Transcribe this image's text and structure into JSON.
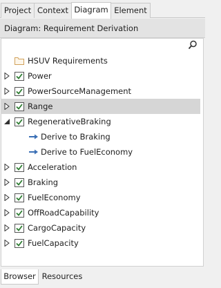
{
  "tabs": {
    "project": "Project",
    "context": "Context",
    "diagram": "Diagram",
    "element": "Element"
  },
  "diagram_bar": {
    "title": "Diagram: Requirement Derivation"
  },
  "search": {
    "icon": "search-icon"
  },
  "tree": {
    "package": "HSUV Requirements",
    "items": [
      {
        "label": "Power",
        "expander": "collapsed"
      },
      {
        "label": "PowerSourceManagement",
        "expander": "collapsed"
      },
      {
        "label": "Range",
        "expander": "collapsed",
        "selected": true
      },
      {
        "label": "RegenerativeBraking",
        "expander": "expanded"
      }
    ],
    "children": [
      {
        "label": "Derive to Braking"
      },
      {
        "label": "Derive to FuelEconomy"
      }
    ],
    "more": [
      {
        "label": "Acceleration"
      },
      {
        "label": "Braking"
      },
      {
        "label": "FuelEconomy"
      },
      {
        "label": "OffRoadCapability"
      },
      {
        "label": "CargoCapacity"
      },
      {
        "label": "FuelCapacity"
      }
    ]
  },
  "bottom_tabs": {
    "browser": "Browser",
    "resources": "Resources"
  },
  "colors": {
    "selected_row": "#d6d6d6",
    "requirement_icon": "#2e7d32",
    "package_icon": "#d1a15a",
    "connector_icon": "#3a6fb5"
  }
}
